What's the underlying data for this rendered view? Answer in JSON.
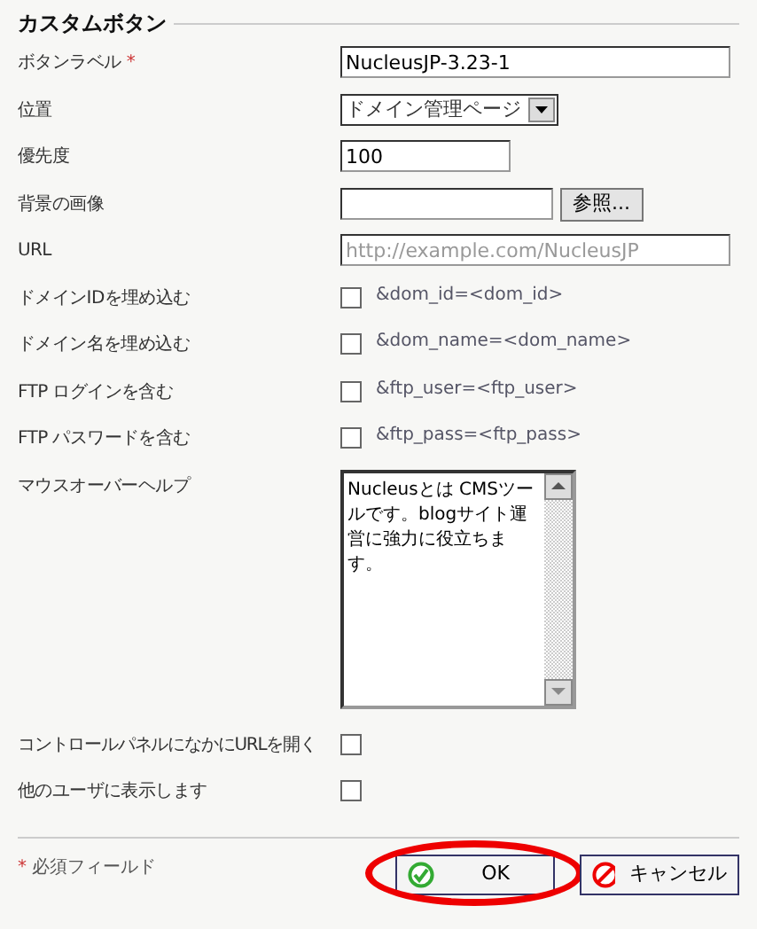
{
  "section_title": "カスタムボタン",
  "fields": [
    {
      "kind": "text",
      "label": "ボタンラベル",
      "required": true,
      "value": "NucleusJP-3.23-1"
    },
    {
      "kind": "select",
      "label": "位置",
      "value": "ドメイン管理ページ"
    },
    {
      "kind": "text",
      "label": "優先度",
      "value": "100",
      "short": true
    },
    {
      "kind": "file",
      "label": "背景の画像",
      "button": "参照..."
    },
    {
      "kind": "text",
      "label": "URL",
      "placeholder": "http://example.com/NucleusJP"
    },
    {
      "kind": "checkbox",
      "label": "ドメインIDを埋め込む",
      "checked": false,
      "hint": "&dom_id=<dom_id>"
    },
    {
      "kind": "checkbox",
      "label": "ドメイン名を埋め込む",
      "checked": false,
      "hint": "&dom_name=<dom_name>"
    },
    {
      "kind": "checkbox",
      "label": "FTP ログインを含む",
      "checked": false,
      "hint": "&ftp_user=<ftp_user>"
    },
    {
      "kind": "checkbox",
      "label": "FTP パスワードを含む",
      "checked": false,
      "hint": "&ftp_pass=<ftp_pass>"
    },
    {
      "kind": "textarea",
      "label": "マウスオーバーヘルプ",
      "value": "Nucleusとは CMSツールです。blogサイト運営に強力に役立ちます。"
    },
    {
      "kind": "checkbox",
      "label": "コントロールパネルになかにURLを開く",
      "checked": false
    },
    {
      "kind": "checkbox",
      "label": "他のユーザに表示します",
      "checked": false
    }
  ],
  "required_mark": "*",
  "required_note": "必須フィールド",
  "buttons": [
    {
      "kind": "ok",
      "label": "OK",
      "highlighted": true
    },
    {
      "kind": "cancel",
      "label": "キャンセル",
      "highlighted": false
    }
  ]
}
